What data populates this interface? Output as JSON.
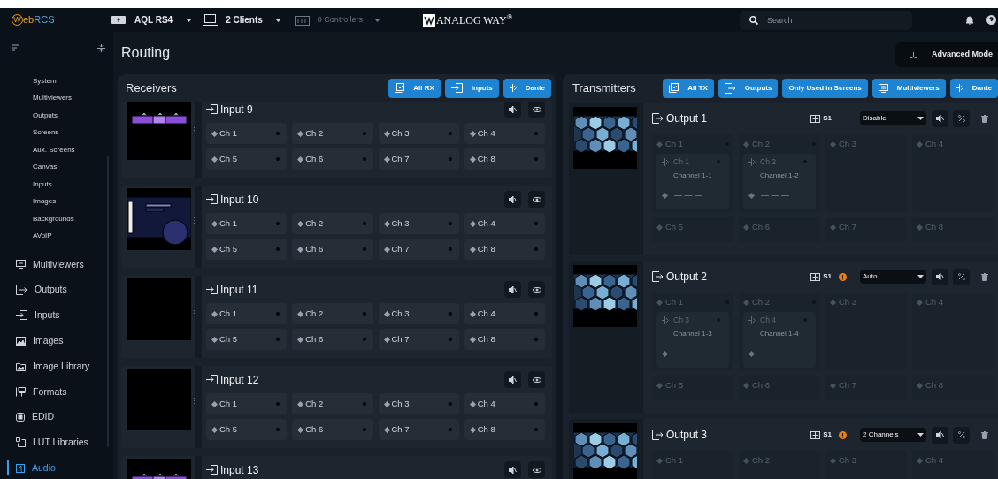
{
  "top_bar": {
    "app_name": "WebRCS",
    "device": "AQL RS4",
    "clients": "2 Clients",
    "controllers": {
      "label": "0 Controllers",
      "disabled": true
    },
    "brand": "ANALOG WAY$^{®}$",
    "search": {
      "placeholder": "Search"
    }
  },
  "sidebar": {
    "sub_items": [
      {
        "label": "System",
        "selected": false
      },
      {
        "label": "Multiviewers",
        "selected": false
      },
      {
        "label": "Outputs",
        "selected": false
      },
      {
        "label": "Screens",
        "selected": false
      },
      {
        "label": "Aux. Screens",
        "selected": false
      },
      {
        "label": "Canvas",
        "selected": false
      },
      {
        "label": "Inputs",
        "selected": false
      },
      {
        "label": "Images",
        "selected": false
      },
      {
        "label": "Backgrounds",
        "selected": false
      },
      {
        "label": "AVoIP",
        "selected": false
      }
    ],
    "items": [
      {
        "label": "Multiviewers",
        "selected": false
      },
      {
        "label": "Outputs",
        "selected": false
      },
      {
        "label": "Inputs",
        "selected": false
      },
      {
        "label": "Images",
        "selected": false
      },
      {
        "label": "Image Library",
        "selected": false
      },
      {
        "label": "Formats",
        "selected": false
      },
      {
        "label": "EDID",
        "selected": false
      },
      {
        "label": "LUT Libraries",
        "selected": false
      },
      {
        "label": "Audio",
        "selected": true
      }
    ]
  },
  "page": {
    "title": "Routing",
    "mode_button": "Advanced Mode"
  },
  "receivers": {
    "title": "Receivers",
    "buttons": [
      "All RX",
      "Inputs",
      "Dante"
    ],
    "inputs": [
      {
        "name": "Input 9",
        "preview": {
          "kind": "stage"
        },
        "channels": [
          "Ch 1",
          "Ch 2",
          "Ch 3",
          "Ch 4",
          "Ch 5",
          "Ch 6",
          "Ch 7",
          "Ch 8"
        ]
      },
      {
        "name": "Input 10",
        "preview": {
          "kind": "slide"
        },
        "channels": [
          "Ch 1",
          "Ch 2",
          "Ch 3",
          "Ch 4",
          "Ch 5",
          "Ch 6",
          "Ch 7",
          "Ch 8"
        ]
      },
      {
        "name": "Input 11",
        "preview": {
          "kind": "blank"
        },
        "channels": [
          "Ch 1",
          "Ch 2",
          "Ch 3",
          "Ch 4",
          "Ch 5",
          "Ch 6",
          "Ch 7",
          "Ch 8"
        ]
      },
      {
        "name": "Input 12",
        "preview": {
          "kind": "blank"
        },
        "channels": [
          "Ch 1",
          "Ch 2",
          "Ch 3",
          "Ch 4",
          "Ch 5",
          "Ch 6",
          "Ch 7",
          "Ch 8"
        ]
      },
      {
        "name": "Input 13",
        "preview": {
          "kind": "stage"
        }
      }
    ]
  },
  "transmitters": {
    "title": "Transmitters",
    "buttons": [
      "All TX",
      "Outputs",
      "Only Used in Screens",
      "Multiviewers",
      "Dante"
    ],
    "outputs": [
      {
        "name": "Output 1",
        "screen": "S1",
        "warning": false,
        "mode": "Disable",
        "channels": [
          {
            "name": "Ch 1",
            "route": {
              "source": "Ch 1",
              "label": "Channel 1-1",
              "slot": "— — —"
            }
          },
          {
            "name": "Ch 2",
            "route": {
              "source": "Ch 2",
              "label": "Channel 1-2",
              "slot": "— — —"
            }
          },
          {
            "name": "Ch 3"
          },
          {
            "name": "Ch 4"
          },
          {
            "name": "Ch 5"
          },
          {
            "name": "Ch 6"
          },
          {
            "name": "Ch 7"
          },
          {
            "name": "Ch 8"
          }
        ]
      },
      {
        "name": "Output 2",
        "screen": "S1",
        "warning": true,
        "mode": "Auto",
        "channels": [
          {
            "name": "Ch 1",
            "route": {
              "source": "Ch 3",
              "label": "Channel 1-3",
              "slot": "— — —"
            }
          },
          {
            "name": "Ch 2",
            "route": {
              "source": "Ch 4",
              "label": "Channel 1-4",
              "slot": "— — —"
            }
          },
          {
            "name": "Ch 3"
          },
          {
            "name": "Ch 4"
          },
          {
            "name": "Ch 5"
          },
          {
            "name": "Ch 6"
          },
          {
            "name": "Ch 7"
          },
          {
            "name": "Ch 8"
          }
        ]
      },
      {
        "name": "Output 3",
        "screen": "S1",
        "warning": true,
        "mode": "2 Channels",
        "channels": [
          {
            "name": "Ch 1"
          },
          {
            "name": "Ch 2"
          },
          {
            "name": "Ch 3"
          },
          {
            "name": "Ch 4"
          }
        ]
      }
    ]
  }
}
